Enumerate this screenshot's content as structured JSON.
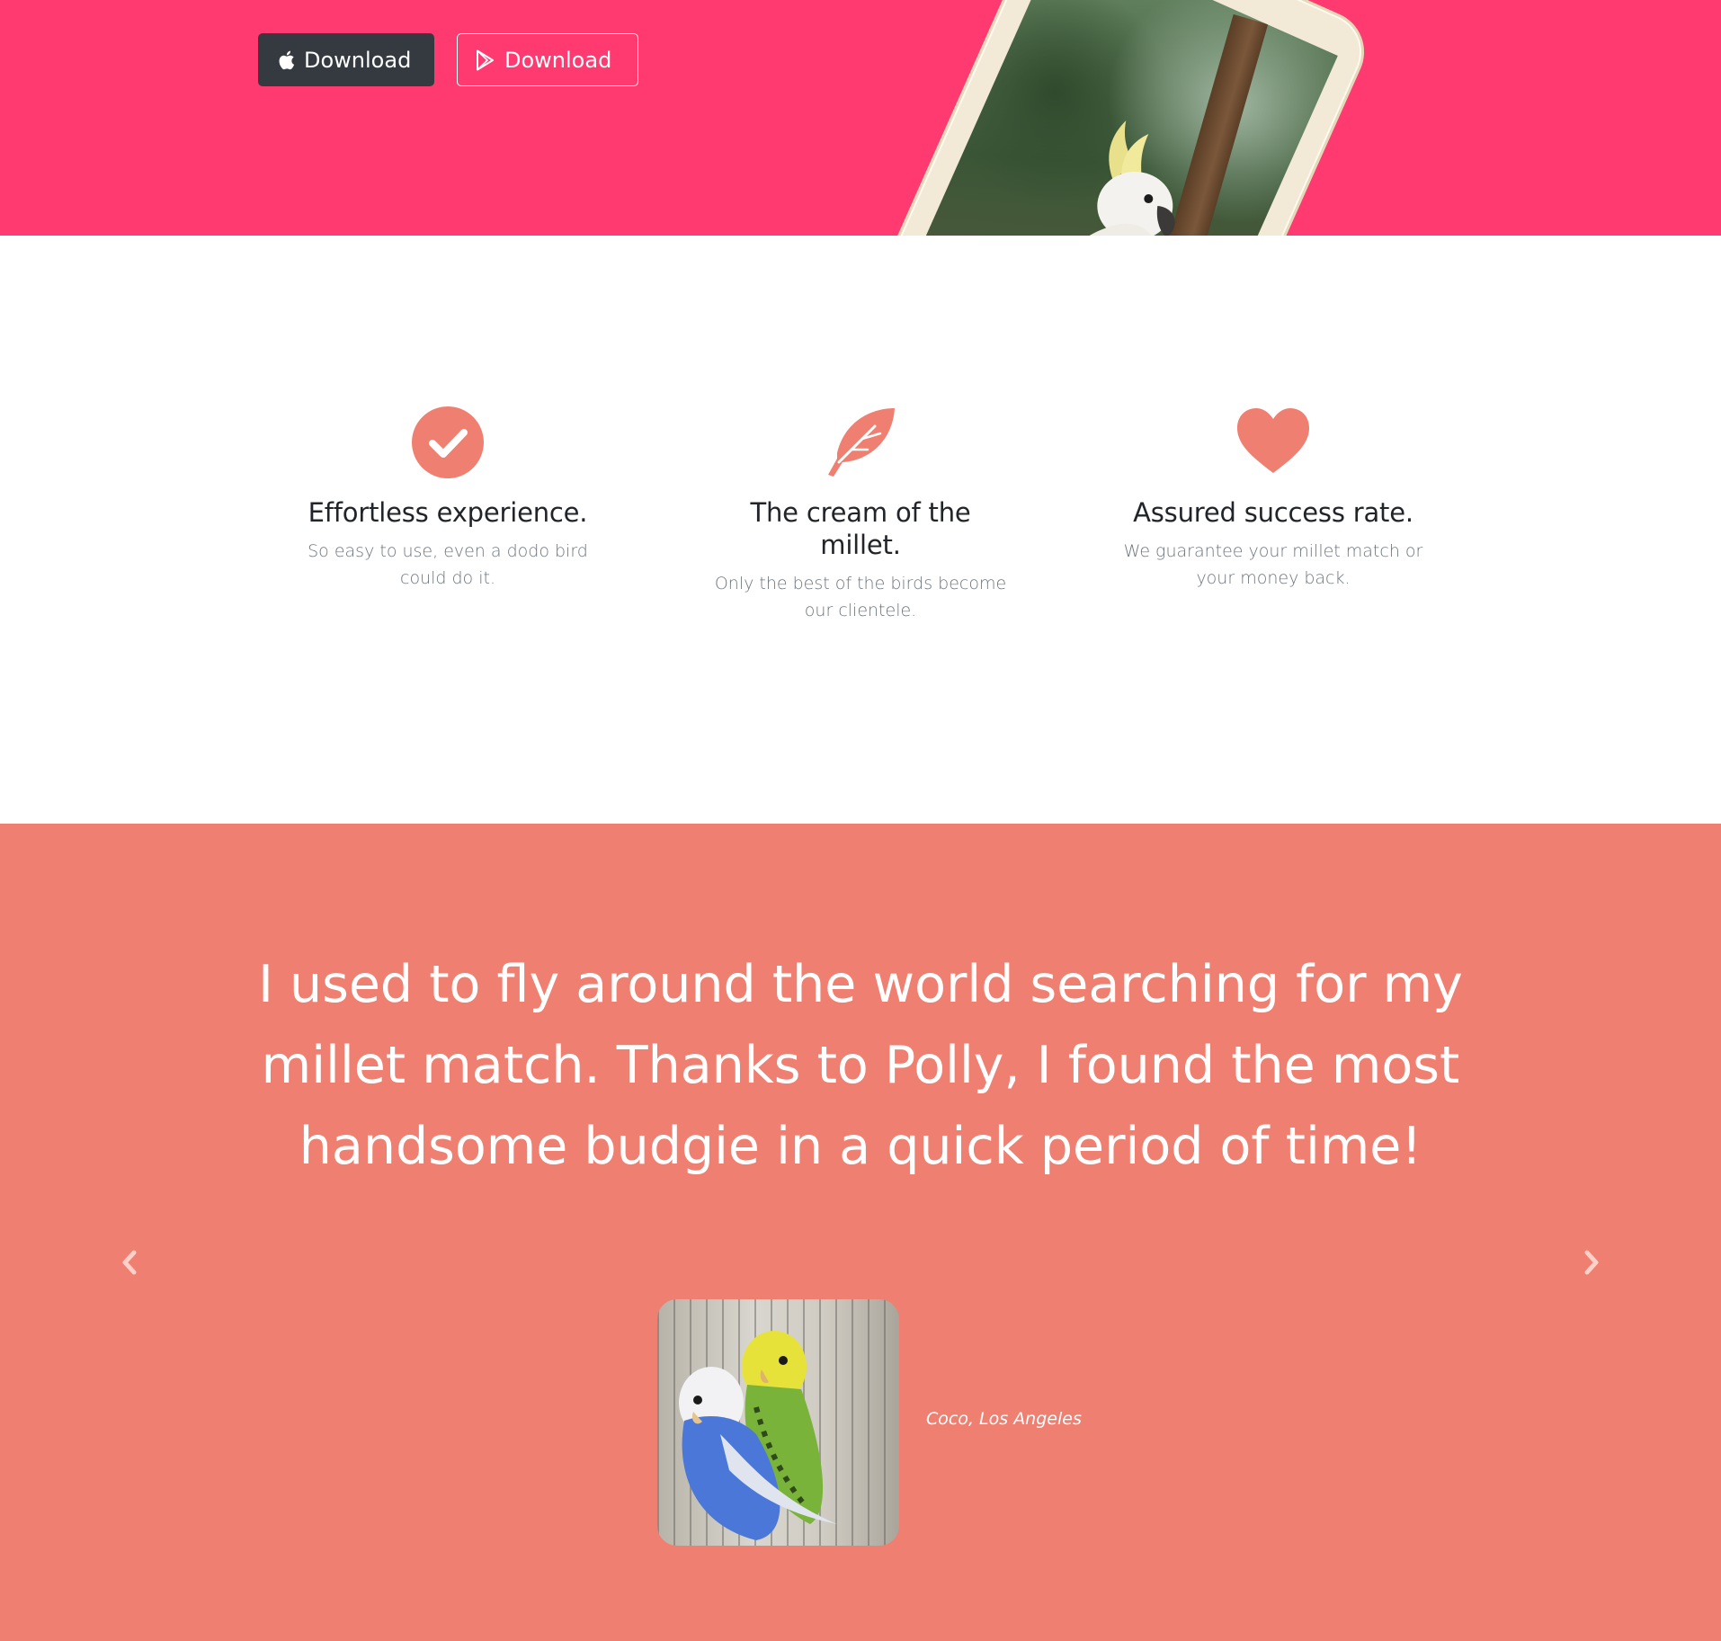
{
  "hero": {
    "apple_button_label": "Download",
    "play_button_label": "Download",
    "background_color": "#ff3a70"
  },
  "features": [
    {
      "icon": "check-circle-icon",
      "title": "Effortless experience.",
      "description": "So easy to use, even a dodo bird could do it."
    },
    {
      "icon": "feather-icon",
      "title": "The cream of the millet.",
      "description": "Only the best of the birds become our clientele."
    },
    {
      "icon": "heart-icon",
      "title": "Assured success rate.",
      "description": "We guarantee your millet match or your money back."
    }
  ],
  "testimonial": {
    "quote": "I used to fly around the world searching for my millet match. Thanks to Polly, I found the most handsome budgie in a quick period of time!",
    "author": "Coco, Los Angeles",
    "background_color": "#ef7f70"
  },
  "colors": {
    "accent": "#ef7f70",
    "dark_button": "#343a40"
  }
}
